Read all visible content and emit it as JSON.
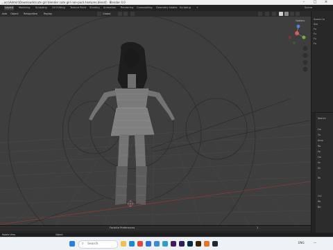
{
  "window": {
    "title": "...ocs\\Admin\\Downloads\\cute girl blender cute girl non-pack textures.blend] - Blender 4.0"
  },
  "workspace_tabs": [
    {
      "label": "Layout",
      "active": true
    },
    {
      "label": "Modeling",
      "active": false
    },
    {
      "label": "Sculpting",
      "active": false
    },
    {
      "label": "UV Editing",
      "active": false
    },
    {
      "label": "Texture Paint",
      "active": false
    },
    {
      "label": "Shading",
      "active": false
    },
    {
      "label": "Animation",
      "active": false
    },
    {
      "label": "Rendering",
      "active": false
    },
    {
      "label": "Compositing",
      "active": false
    },
    {
      "label": "Geometry Nodes",
      "active": false
    },
    {
      "label": "Scripting",
      "active": false
    },
    {
      "label": "+",
      "active": false
    }
  ],
  "scene_label": "Scene",
  "header": {
    "menu": [
      "Add",
      "Object",
      "Retopoflow",
      "Replay"
    ],
    "transform_orientation": "Global",
    "options_label": "Options"
  },
  "outliner": {
    "items": [
      "Scene Co",
      "Sce",
      "Fu",
      "Fu",
      "Fu",
      "Fu"
    ]
  },
  "properties": {
    "items": [
      "Search",
      "Fw",
      "Tx",
      "Ame",
      "Ro",
      "Fe",
      "Oo",
      "Hr",
      "Di",
      "Sh",
      "Cul",
      "Re",
      "Be"
    ]
  },
  "timeline": {
    "center_label": "Fortnite Preferences",
    "current_frame": "1"
  },
  "status_bar": {
    "left": "Rotate View",
    "center": "Object"
  },
  "taskbar": {
    "search_placeholder": "Search",
    "icons": [
      "windows-icon",
      "file-explorer-icon",
      "edge-icon",
      "chrome-icon",
      "store-icon",
      "mail-icon",
      "photos-icon",
      "premiere-icon",
      "after-effects-icon",
      "photoshop-icon",
      "illustrator-icon",
      "blender-icon",
      "steam-icon"
    ],
    "tray": {
      "lang": "ENG",
      "time": "—"
    }
  },
  "colors": {
    "viewport_bg": "#3e3e3e",
    "grid": "#4a4a4a",
    "x_axis": "#8b3a3a",
    "selected_tab": "#3b3b3b",
    "taskbar": "#eef1f5"
  }
}
